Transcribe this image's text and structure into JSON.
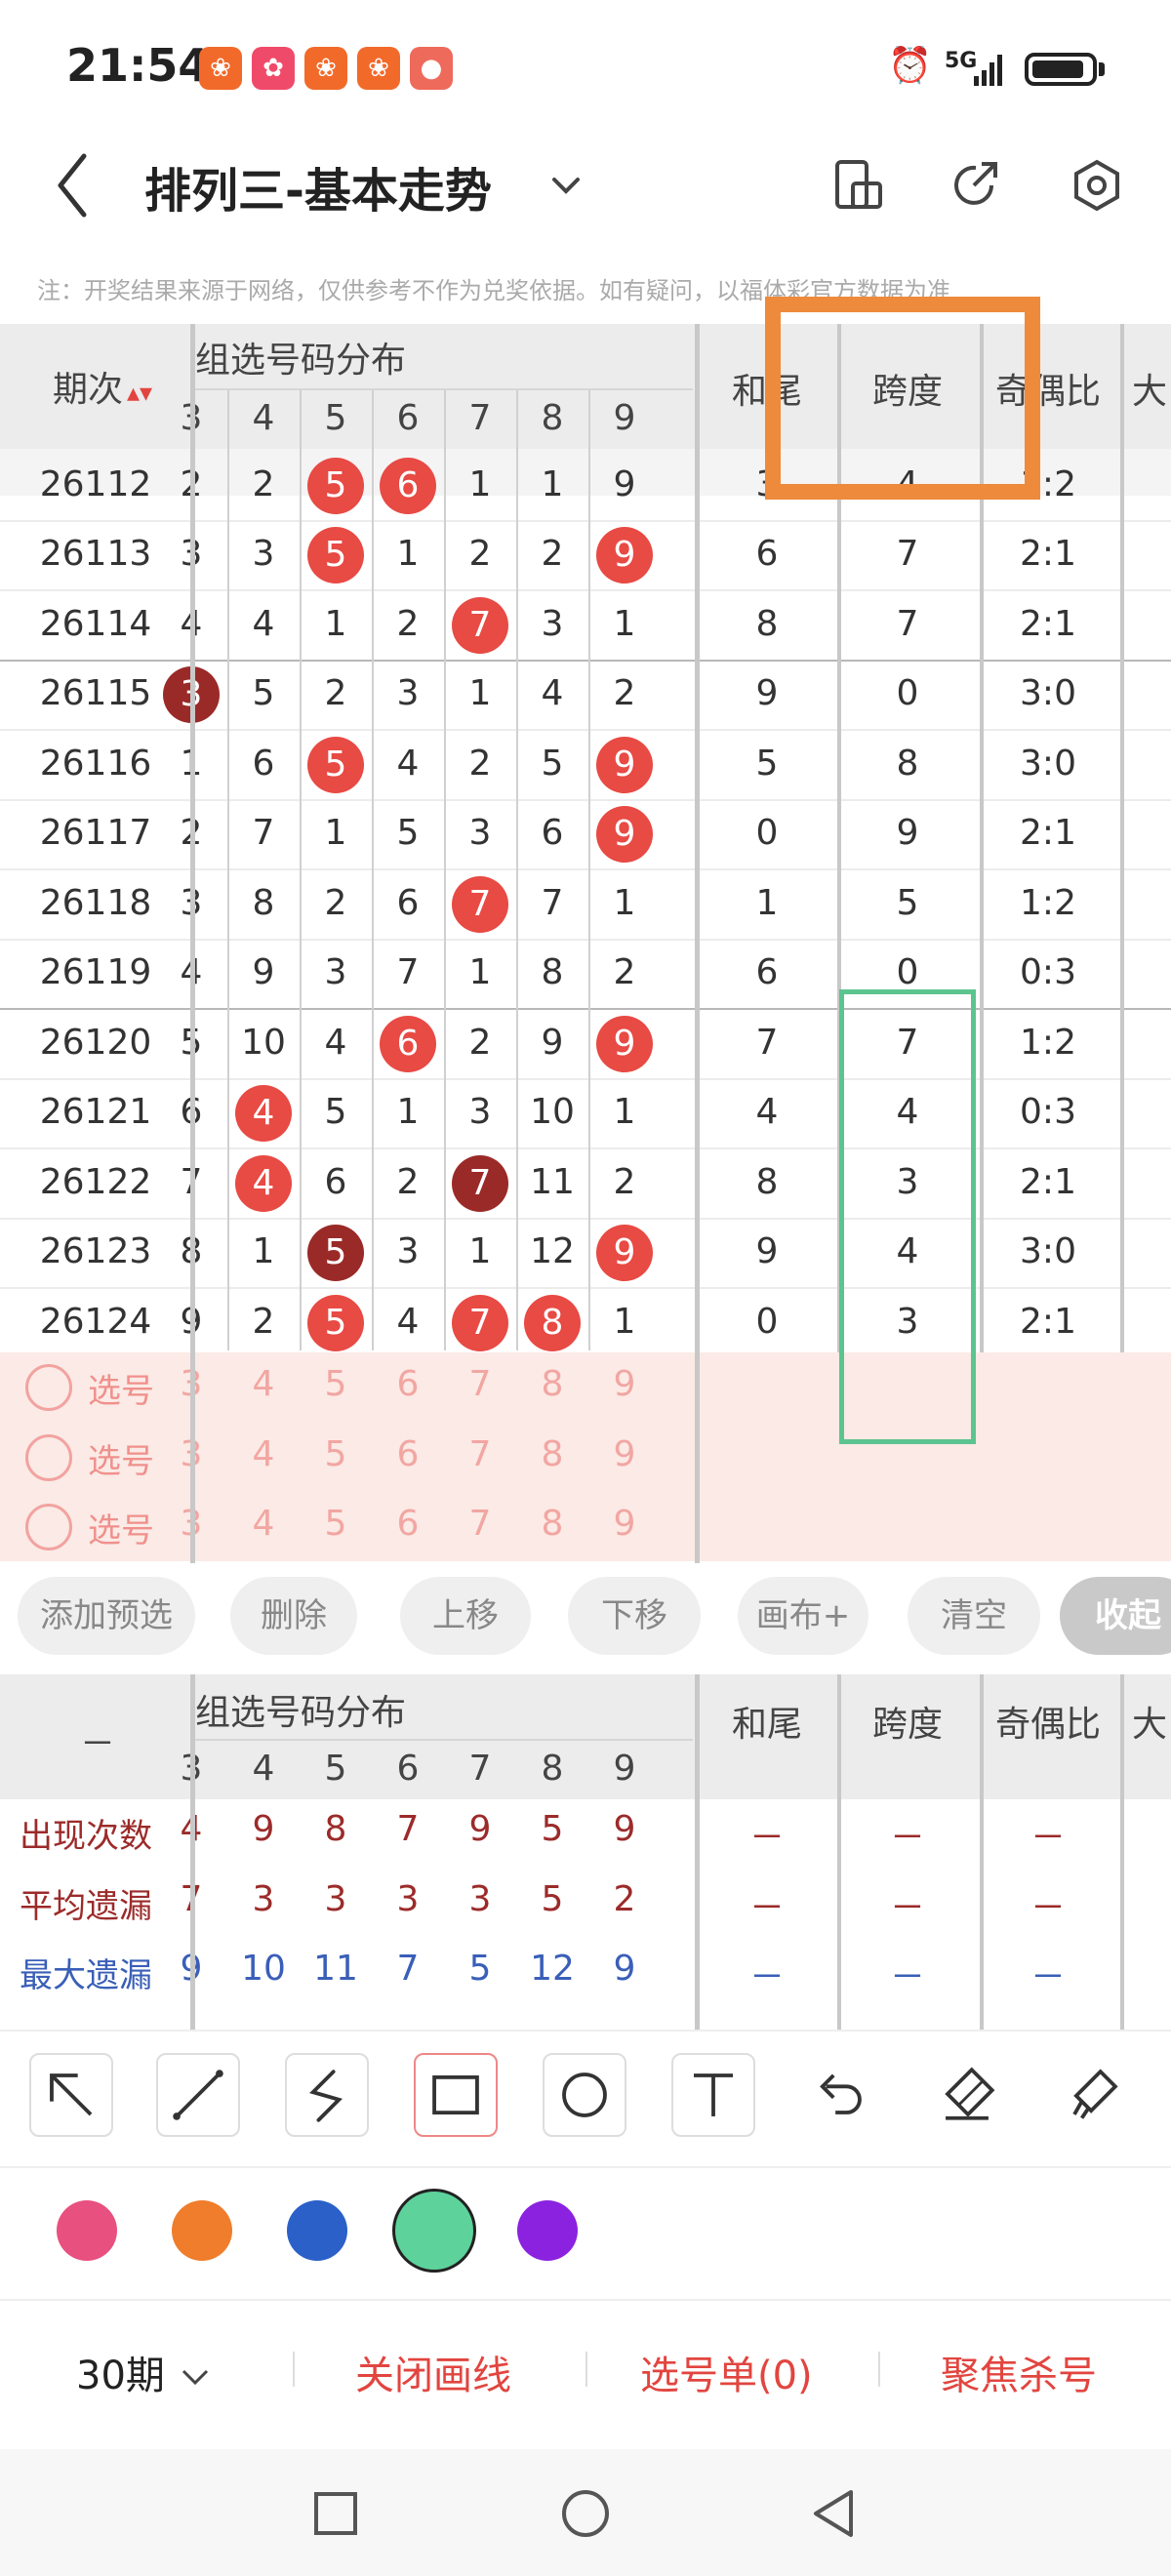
{
  "status_bar": {
    "time": "21:54",
    "network": "5G",
    "app_icons": [
      "app-icon",
      "app-icon",
      "app-icon",
      "app-icon",
      "app-icon"
    ]
  },
  "header": {
    "title": "排列三-基本走势",
    "dropdown_icon": "chevron-down-icon",
    "icons": [
      "phone-layout-icon",
      "share-icon",
      "settings-icon"
    ]
  },
  "notice": "注：开奖结果来源于网络，仅供参考不作为兑奖依据。如有疑问，以福体彩官方数据为准",
  "table": {
    "period_header": "期次",
    "group_header": "组选号码分布",
    "digit_headers": [
      "3",
      "4",
      "5",
      "6",
      "7",
      "8",
      "9"
    ],
    "extra_headers": [
      "和尾",
      "跨度",
      "奇偶比",
      "大"
    ],
    "rows": [
      {
        "period": "26112",
        "cells": [
          "2",
          "2",
          "5",
          "6",
          "1",
          "1",
          "9"
        ],
        "hewei": "3",
        "kuadu": "4",
        "jiou": "1:2"
      },
      {
        "period": "26113",
        "cells": [
          "3",
          "3",
          "5",
          "1",
          "2",
          "2",
          "9"
        ],
        "hewei": "6",
        "kuadu": "7",
        "jiou": "2:1"
      },
      {
        "period": "26114",
        "cells": [
          "4",
          "4",
          "1",
          "2",
          "7",
          "3",
          "1"
        ],
        "hewei": "8",
        "kuadu": "7",
        "jiou": "2:1"
      },
      {
        "period": "26115",
        "cells": [
          "3",
          "5",
          "2",
          "3",
          "1",
          "4",
          "2"
        ],
        "hewei": "9",
        "kuadu": "0",
        "jiou": "3:0"
      },
      {
        "period": "26116",
        "cells": [
          "1",
          "6",
          "5",
          "4",
          "2",
          "5",
          "9"
        ],
        "hewei": "5",
        "kuadu": "8",
        "jiou": "3:0"
      },
      {
        "period": "26117",
        "cells": [
          "2",
          "7",
          "1",
          "5",
          "3",
          "6",
          "9"
        ],
        "hewei": "0",
        "kuadu": "9",
        "jiou": "2:1"
      },
      {
        "period": "26118",
        "cells": [
          "3",
          "8",
          "2",
          "6",
          "7",
          "7",
          "1"
        ],
        "hewei": "1",
        "kuadu": "5",
        "jiou": "1:2"
      },
      {
        "period": "26119",
        "cells": [
          "4",
          "9",
          "3",
          "7",
          "1",
          "8",
          "2"
        ],
        "hewei": "6",
        "kuadu": "0",
        "jiou": "0:3"
      },
      {
        "period": "26120",
        "cells": [
          "5",
          "10",
          "4",
          "6",
          "2",
          "9",
          "9"
        ],
        "hewei": "7",
        "kuadu": "7",
        "jiou": "1:2"
      },
      {
        "period": "26121",
        "cells": [
          "6",
          "4",
          "5",
          "1",
          "3",
          "10",
          "1"
        ],
        "hewei": "4",
        "kuadu": "4",
        "jiou": "0:3"
      },
      {
        "period": "26122",
        "cells": [
          "7",
          "4",
          "6",
          "2",
          "7",
          "11",
          "2"
        ],
        "hewei": "8",
        "kuadu": "3",
        "jiou": "2:1"
      },
      {
        "period": "26123",
        "cells": [
          "8",
          "1",
          "5",
          "3",
          "1",
          "12",
          "9"
        ],
        "hewei": "9",
        "kuadu": "4",
        "jiou": "3:0"
      },
      {
        "period": "26124",
        "cells": [
          "9",
          "2",
          "5",
          "4",
          "7",
          "8",
          "1"
        ],
        "hewei": "0",
        "kuadu": "3",
        "jiou": "2:1"
      }
    ],
    "balls": [
      [
        0,
        2,
        "red"
      ],
      [
        0,
        3,
        "red"
      ],
      [
        1,
        2,
        "red"
      ],
      [
        1,
        6,
        "red"
      ],
      [
        2,
        4,
        "red"
      ],
      [
        3,
        0,
        "dark"
      ],
      [
        4,
        2,
        "red"
      ],
      [
        4,
        6,
        "red"
      ],
      [
        5,
        6,
        "red"
      ],
      [
        6,
        4,
        "red"
      ],
      [
        8,
        3,
        "red"
      ],
      [
        8,
        6,
        "red"
      ],
      [
        9,
        1,
        "red"
      ],
      [
        10,
        1,
        "red"
      ],
      [
        10,
        4,
        "dark"
      ],
      [
        11,
        2,
        "dark"
      ],
      [
        11,
        6,
        "red"
      ],
      [
        12,
        2,
        "red"
      ],
      [
        12,
        4,
        "red"
      ],
      [
        12,
        5,
        "red"
      ]
    ],
    "pick_rows": [
      {
        "label": "选号",
        "nums": [
          "3",
          "4",
          "5",
          "6",
          "7",
          "8",
          "9"
        ]
      },
      {
        "label": "选号",
        "nums": [
          "3",
          "4",
          "5",
          "6",
          "7",
          "8",
          "9"
        ]
      },
      {
        "label": "选号",
        "nums": [
          "3",
          "4",
          "5",
          "6",
          "7",
          "8",
          "9"
        ]
      }
    ]
  },
  "toolbar_pills": [
    "添加预选",
    "删除",
    "上移",
    "下移",
    "画布+",
    "清空",
    "收起"
  ],
  "stats": {
    "corner": "－",
    "group_header": "组选号码分布",
    "digit_headers": [
      "3",
      "4",
      "5",
      "6",
      "7",
      "8",
      "9"
    ],
    "extra_headers": [
      "和尾",
      "跨度",
      "奇偶比",
      "大"
    ],
    "rows": [
      {
        "label": "出现次数",
        "values": [
          "4",
          "9",
          "8",
          "7",
          "9",
          "5",
          "9"
        ],
        "extra": [
          "－",
          "－",
          "－"
        ],
        "color": "#9b2b2a"
      },
      {
        "label": "平均遗漏",
        "values": [
          "7",
          "3",
          "3",
          "3",
          "3",
          "5",
          "2"
        ],
        "extra": [
          "－",
          "－",
          "－"
        ],
        "color": "#9b2b2a"
      },
      {
        "label": "最大遗漏",
        "values": [
          "9",
          "10",
          "11",
          "7",
          "5",
          "12",
          "9"
        ],
        "extra": [
          "－",
          "－",
          "－"
        ],
        "color": "#3a5fb8"
      }
    ]
  },
  "drawing_tools": [
    "arrow-tool-icon",
    "line-tool-icon",
    "freehand-tool-icon",
    "rectangle-tool-icon",
    "circle-tool-icon",
    "text-tool-icon",
    "undo-icon",
    "eraser-icon",
    "brush-icon"
  ],
  "colors": [
    "#e8507f",
    "#ef7d2c",
    "#2a60c8",
    "#5dd39b",
    "#8a22e0"
  ],
  "bottom_bar": {
    "period_select": "30期",
    "close_lines": "关闭画线",
    "selection": "选号单(0)",
    "focus": "聚焦杀号"
  },
  "annotation_colors": {
    "orange_box": "#ee8a3c",
    "green_box": "#5cc48f"
  }
}
